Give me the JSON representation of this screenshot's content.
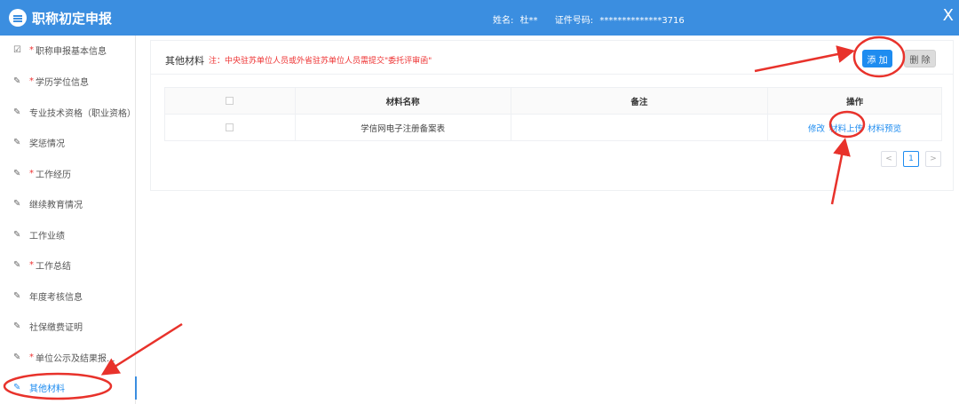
{
  "header": {
    "title": "职称初定申报",
    "name_label": "姓名:",
    "name_value": "杜**",
    "id_label": "证件号码:",
    "id_value": "**************3716",
    "close_glyph": "X",
    "bg_color": "#3b8ee0"
  },
  "sidebar": {
    "items": [
      {
        "label": "职称申报基本信息",
        "required": true,
        "icon": "edit-square-icon",
        "glyph": "☑"
      },
      {
        "label": "学历学位信息",
        "required": true,
        "icon": "pencil-icon",
        "glyph": "✎"
      },
      {
        "label": "专业技术资格（职业资格）",
        "required": false,
        "icon": "pencil-icon",
        "glyph": "✎"
      },
      {
        "label": "奖惩情况",
        "required": false,
        "icon": "pencil-icon",
        "glyph": "✎"
      },
      {
        "label": "工作经历",
        "required": true,
        "icon": "pencil-icon",
        "glyph": "✎"
      },
      {
        "label": "继续教育情况",
        "required": false,
        "icon": "pencil-icon",
        "glyph": "✎"
      },
      {
        "label": "工作业绩",
        "required": false,
        "icon": "pencil-icon",
        "glyph": "✎"
      },
      {
        "label": "工作总结",
        "required": true,
        "icon": "pencil-icon",
        "glyph": "✎"
      },
      {
        "label": "年度考核信息",
        "required": false,
        "icon": "pencil-icon",
        "glyph": "✎"
      },
      {
        "label": "社保缴费证明",
        "required": false,
        "icon": "pencil-icon",
        "glyph": "✎"
      },
      {
        "label": "单位公示及结果报...",
        "required": true,
        "icon": "pencil-icon",
        "glyph": "✎"
      },
      {
        "label": "其他材料",
        "required": false,
        "icon": "pencil-icon",
        "glyph": "✎",
        "active": true
      }
    ],
    "required_mark": "*"
  },
  "panel": {
    "title": "其他材料",
    "note": "注：中央驻苏单位人员或外省驻苏单位人员需提交\"委托评审函\"",
    "add_label": "添 加",
    "delete_label": "删 除"
  },
  "table": {
    "headers": [
      "",
      "材料名称",
      "备注",
      "操作"
    ],
    "rows": [
      {
        "name": "学信网电子注册备案表",
        "remark": "",
        "actions": [
          "修改",
          "材料上传",
          "材料预览"
        ]
      }
    ]
  },
  "pagination": {
    "prev": "<",
    "current": "1",
    "next": ">"
  },
  "annotation_color": "#e8322b",
  "accent_color": "#1e8cf0"
}
